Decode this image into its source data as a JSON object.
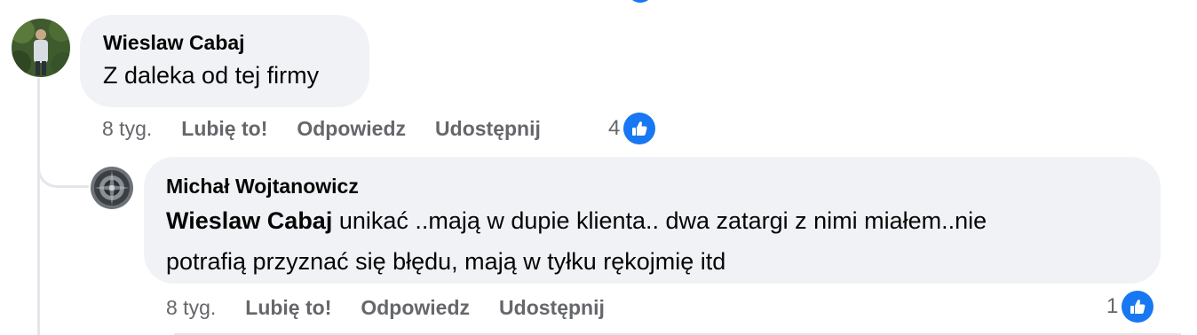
{
  "comments": [
    {
      "author": "Wieslaw Cabaj",
      "text": "Z daleka od tej firmy",
      "time": "8 tyg.",
      "like_label": "Lubię to!",
      "reply_label": "Odpowiedz",
      "share_label": "Udostępnij",
      "reaction_count": "4"
    },
    {
      "author": "Michał Wojtanowicz",
      "mention": "Wieslaw Cabaj",
      "text_line1": " unikać ..mają w dupie klienta.. dwa zatargi z nimi miałem..nie",
      "text_line2": "potrafią przyznać się błędu, mają w tyłku rękojmię itd",
      "time": "8 tyg.",
      "like_label": "Lubię to!",
      "reply_label": "Odpowiedz",
      "share_label": "Udostępnij",
      "reaction_count": "1"
    }
  ],
  "icons": {
    "reaction": "thumbs-up-icon",
    "accent": "#1877f2",
    "bubble_bg": "#f0f2f5",
    "muted_text": "#65676b"
  }
}
